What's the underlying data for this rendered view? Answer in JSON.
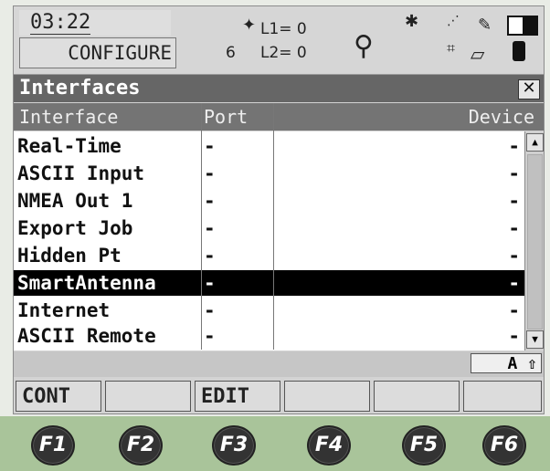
{
  "status": {
    "time": "03:22",
    "mode_panel": "CONFIGURE",
    "sat_count": "6",
    "l1": "L1= 0",
    "l2": "L2= 0",
    "icons": [
      "satellite-icon",
      "surveyor-icon",
      "bluetooth-icon",
      "radio-icon",
      "pen-icon",
      "battery-icon",
      "memory-icon",
      "card-icon"
    ]
  },
  "window": {
    "title": "Interfaces",
    "close_label": "✕"
  },
  "table": {
    "headers": [
      "Interface",
      "Port",
      "Device"
    ],
    "rows": [
      {
        "interface": "Real-Time",
        "port": "-",
        "device": "-"
      },
      {
        "interface": "ASCII Input",
        "port": "-",
        "device": "-"
      },
      {
        "interface": "NMEA Out 1",
        "port": "-",
        "device": "-"
      },
      {
        "interface": "Export Job",
        "port": "-",
        "device": "-"
      },
      {
        "interface": "Hidden Pt",
        "port": "-",
        "device": "-"
      },
      {
        "interface": "SmartAntenna",
        "port": "-",
        "device": "-",
        "selected": true
      },
      {
        "interface": "Internet",
        "port": "-",
        "device": "-"
      },
      {
        "interface": "ASCII Remote",
        "port": "-",
        "device": "-"
      }
    ]
  },
  "input_mode": "A ⇧",
  "softkeys": [
    "CONT",
    "",
    "EDIT",
    "",
    "",
    ""
  ],
  "fkeys": [
    "F1",
    "F2",
    "F3",
    "F4",
    "F5",
    "F6"
  ]
}
